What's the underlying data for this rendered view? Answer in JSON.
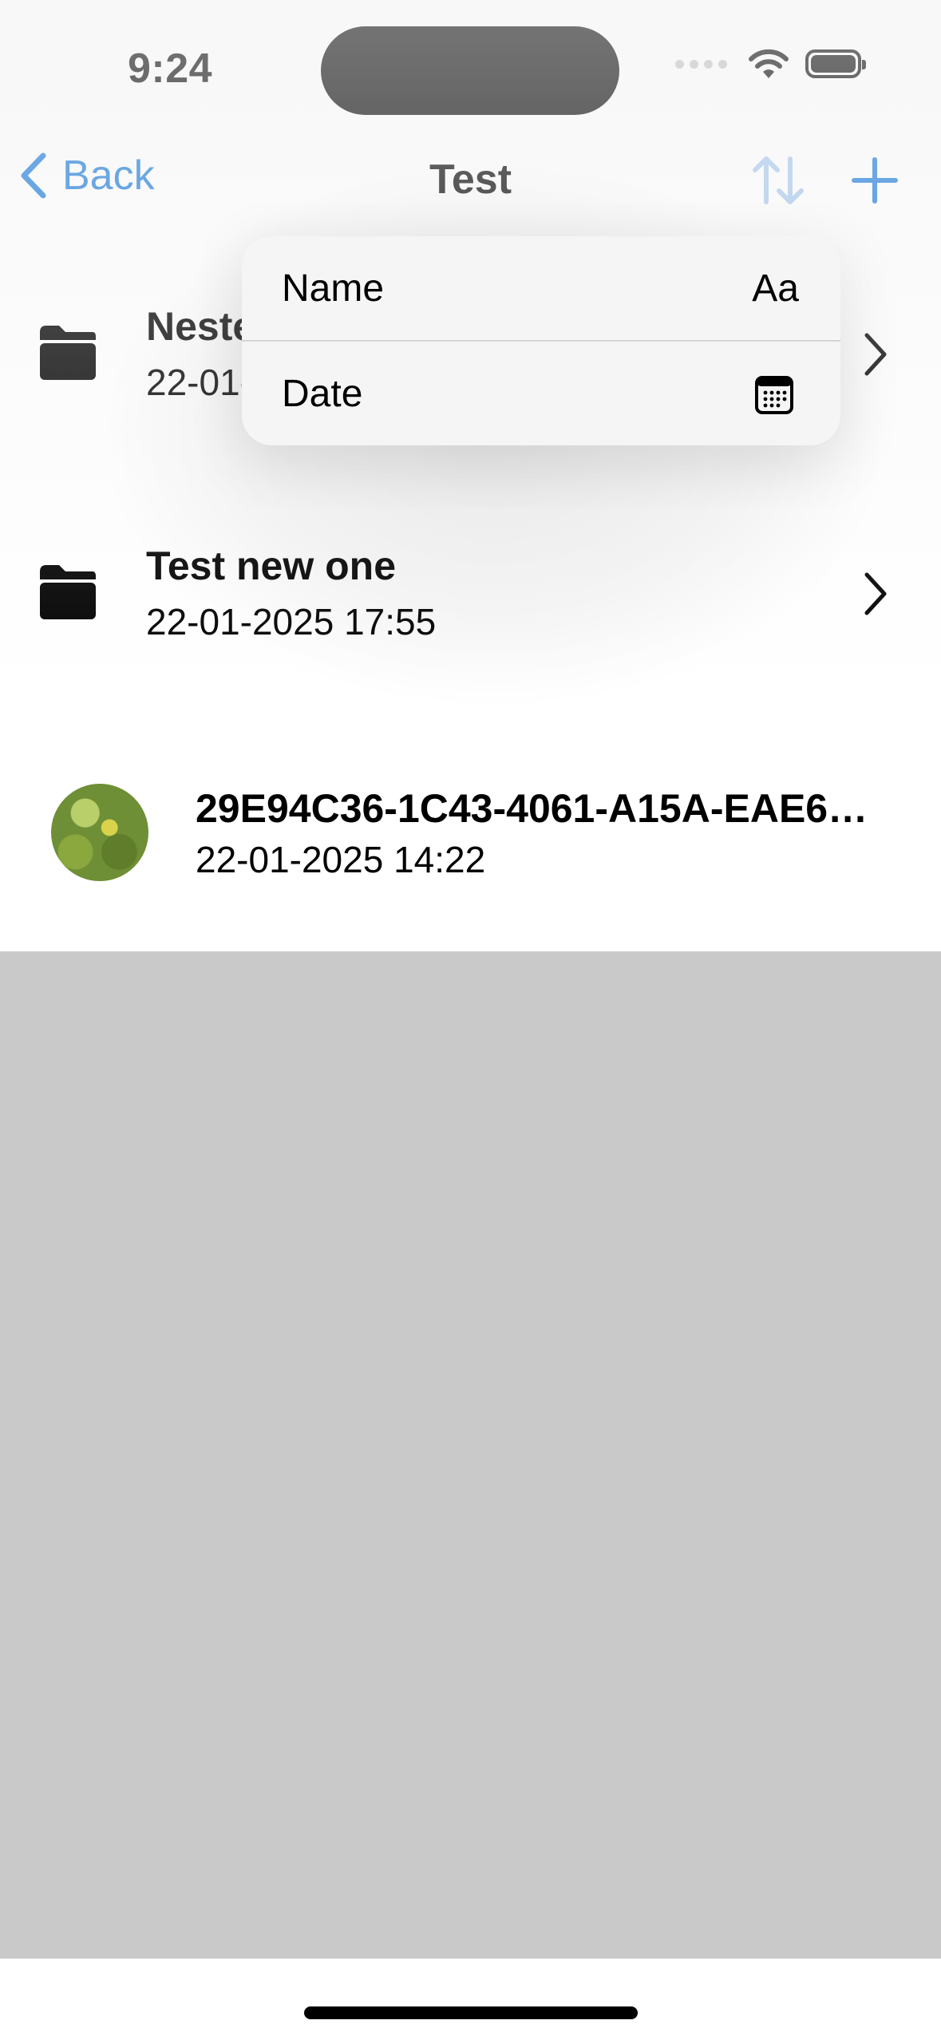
{
  "status_bar": {
    "time": "9:24"
  },
  "nav": {
    "back_label": "Back",
    "title": "Test"
  },
  "items": [
    {
      "type": "folder",
      "title": "Nested",
      "subtitle": "22-01-2025"
    },
    {
      "type": "folder",
      "title": "Test new one",
      "subtitle": "22-01-2025 17:55"
    },
    {
      "type": "image",
      "title": "29E94C36-1C43-4061-A15A-EAE6…",
      "subtitle": "22-01-2025 14:22"
    }
  ],
  "sort_menu": {
    "options": [
      {
        "label": "Name",
        "accessory": "Aa"
      },
      {
        "label": "Date",
        "accessory_icon": "calendar-icon"
      }
    ]
  },
  "colors": {
    "accent": "#1a7bdb",
    "empty_area": "#c9c9c9"
  }
}
